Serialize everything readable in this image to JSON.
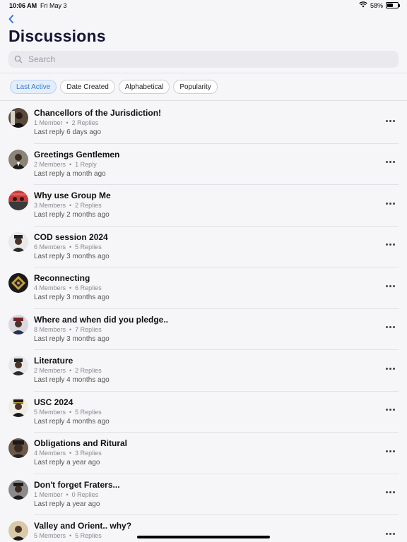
{
  "status": {
    "time": "10:06 AM",
    "date": "Fri May 3",
    "battery_pct": "58%",
    "battery_level": 0.58
  },
  "page": {
    "title": "Discussions"
  },
  "search": {
    "placeholder": "Search"
  },
  "filters": [
    "Last Active",
    "Date Created",
    "Alphabetical",
    "Popularity"
  ],
  "active_filter": "Last Active",
  "discussions": [
    {
      "title": "Chancellors of the Jurisdiction!",
      "members": "1 Member",
      "replies": "2 Replies",
      "last": "Last reply 6 days ago"
    },
    {
      "title": "Greetings Gentlemen",
      "members": "2 Members",
      "replies": "1 Reply",
      "last": "Last reply a month ago"
    },
    {
      "title": "Why use Group Me",
      "members": "3 Members",
      "replies": "2 Replies",
      "last": "Last reply 2 months ago"
    },
    {
      "title": "COD session 2024",
      "members": "6 Members",
      "replies": "5 Replies",
      "last": "Last reply 3 months ago"
    },
    {
      "title": "Reconnecting",
      "members": "4 Members",
      "replies": "6 Replies",
      "last": "Last reply 3 months ago"
    },
    {
      "title": "Where and when did you pledge..",
      "members": "8 Members",
      "replies": "7 Replies",
      "last": "Last reply 3 months ago"
    },
    {
      "title": "Literature",
      "members": "2 Members",
      "replies": "2 Replies",
      "last": "Last reply 4 months ago"
    },
    {
      "title": "USC 2024",
      "members": "5 Members",
      "replies": "5 Replies",
      "last": "Last reply 4 months ago"
    },
    {
      "title": "Obligations and Ritural",
      "members": "4 Members",
      "replies": "3 Replies",
      "last": "Last reply a year ago"
    },
    {
      "title": "Don't forget Fraters...",
      "members": "1 Member",
      "replies": "0 Replies",
      "last": "Last reply a year ago"
    },
    {
      "title": "Valley and Orient.. why?",
      "members": "5 Members",
      "replies": "5 Replies",
      "last": ""
    }
  ],
  "colors": {
    "accent": "#2a6fdb",
    "title": "#151536",
    "chip_active_bg": "#e3eefb",
    "chip_active_text": "#3a7ad0"
  }
}
